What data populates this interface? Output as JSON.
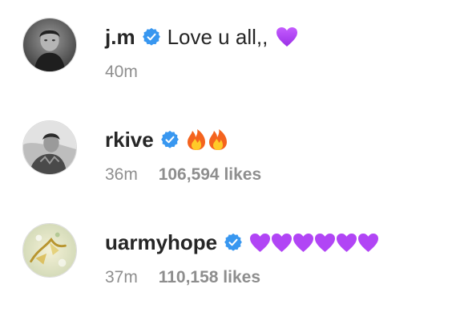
{
  "theme": {
    "verified_color": "#3897f0",
    "secondary_text_color": "#8e8e8e",
    "primary_text_color": "#262626"
  },
  "comments": [
    {
      "username": "j.m",
      "verified": true,
      "text": "Love u all,,",
      "emojis": [
        "purple-heart"
      ],
      "time": "40m",
      "likes": ""
    },
    {
      "username": "rkive",
      "verified": true,
      "text": "",
      "emojis": [
        "fire",
        "fire"
      ],
      "time": "36m",
      "likes": "106,594 likes"
    },
    {
      "username": "uarmyhope",
      "verified": true,
      "text": "",
      "emojis": [
        "purple-heart",
        "purple-heart",
        "purple-heart",
        "purple-heart",
        "purple-heart",
        "purple-heart"
      ],
      "time": "37m",
      "likes": "110,158 likes"
    }
  ]
}
